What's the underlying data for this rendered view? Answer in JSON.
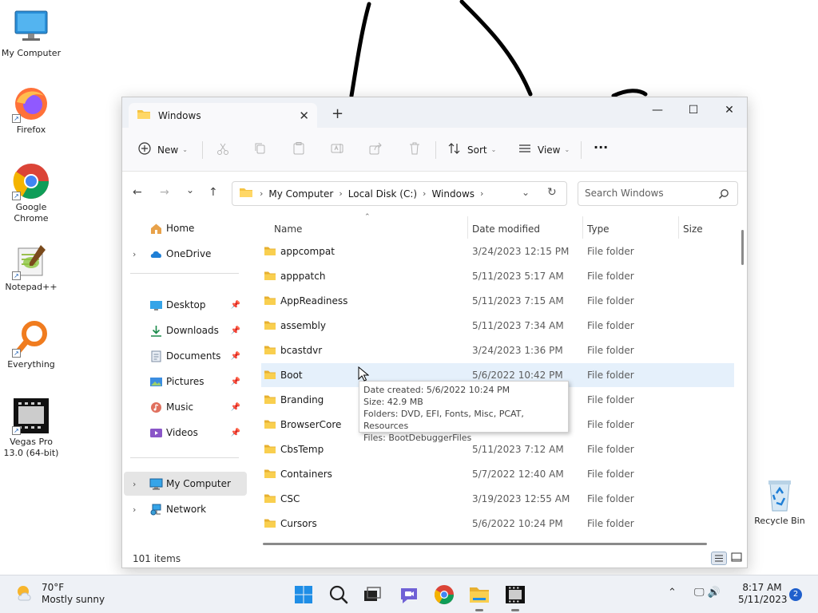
{
  "desktop": {
    "icons": [
      {
        "label": "My Computer"
      },
      {
        "label": "Firefox"
      },
      {
        "label": "Google Chrome"
      },
      {
        "label": "Notepad++"
      },
      {
        "label": "Everything"
      },
      {
        "label": "Vegas Pro 13.0 (64-bit)"
      },
      {
        "label": "Recycle Bin"
      }
    ],
    "shortcut_glyph": "↗"
  },
  "window": {
    "tab_title": "Windows",
    "tab_close": "✕",
    "new_tab": "+",
    "controls": {
      "minimize": "—",
      "maximize": "☐",
      "close": "✕"
    }
  },
  "toolbar": {
    "new_label": "New",
    "sort_label": "Sort",
    "view_label": "View",
    "more_label": "···",
    "chevron": "⌄"
  },
  "navigation": {
    "back": "←",
    "forward": "→",
    "recent": "⌄",
    "up": "↑",
    "breadcrumbs": [
      "My Computer",
      "Local Disk (C:)",
      "Windows"
    ],
    "crumb_sep": "›",
    "dropdown": "⌄",
    "refresh": "↻",
    "search_placeholder": "Search Windows"
  },
  "sidebar": {
    "expander": "›",
    "pin": "📌",
    "items": [
      {
        "label": "Home"
      },
      {
        "label": "OneDrive"
      },
      {
        "label": "Desktop"
      },
      {
        "label": "Downloads"
      },
      {
        "label": "Documents"
      },
      {
        "label": "Pictures"
      },
      {
        "label": "Music"
      },
      {
        "label": "Videos"
      },
      {
        "label": "My Computer"
      },
      {
        "label": "Network"
      }
    ]
  },
  "file_list": {
    "columns": {
      "name": "Name",
      "date": "Date modified",
      "type": "Type",
      "size": "Size"
    },
    "sort_arrow": "⌃",
    "rows": [
      {
        "name": "appcompat",
        "date": "3/24/2023 12:15 PM",
        "type": "File folder"
      },
      {
        "name": "apppatch",
        "date": "5/11/2023 5:17 AM",
        "type": "File folder"
      },
      {
        "name": "AppReadiness",
        "date": "5/11/2023 7:15 AM",
        "type": "File folder"
      },
      {
        "name": "assembly",
        "date": "5/11/2023 7:34 AM",
        "type": "File folder"
      },
      {
        "name": "bcastdvr",
        "date": "3/24/2023 1:36 PM",
        "type": "File folder"
      },
      {
        "name": "Boot",
        "date": "5/6/2022 10:42 PM",
        "type": "File folder"
      },
      {
        "name": "Branding",
        "date": "",
        "type": "File folder"
      },
      {
        "name": "BrowserCore",
        "date": "",
        "type": "File folder"
      },
      {
        "name": "CbsTemp",
        "date": "5/11/2023 7:12 AM",
        "type": "File folder"
      },
      {
        "name": "Containers",
        "date": "5/7/2022 12:40 AM",
        "type": "File folder"
      },
      {
        "name": "CSC",
        "date": "3/19/2023 12:55 AM",
        "type": "File folder"
      },
      {
        "name": "Cursors",
        "date": "5/6/2022 10:24 PM",
        "type": "File folder"
      }
    ]
  },
  "tooltip": {
    "lines": [
      "Date created: 5/6/2022 10:24 PM",
      "Size: 42.9 MB",
      "Folders: DVD, EFI, Fonts, Misc, PCAT, Resources",
      "Files: BootDebuggerFiles"
    ]
  },
  "status": {
    "item_count": "101 items"
  },
  "taskbar": {
    "weather_temp": "70°F",
    "weather_desc": "Mostly sunny",
    "tray_chevron": "⌃",
    "tray_icons": "🖵 🔊",
    "time": "8:17 AM",
    "date": "5/11/2023",
    "notification_count": "2"
  },
  "colors": {
    "accent": "#0067c0",
    "folder": "#f5c342",
    "row_hover": "#e5f0fb",
    "taskbar": "#eef1f6"
  }
}
